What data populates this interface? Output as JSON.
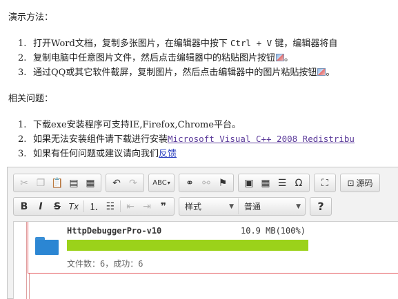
{
  "demo": {
    "heading": "演示方法：",
    "items": [
      {
        "num": "1.",
        "text_a": "打开Word文档，复制多张图片，在编辑器中按下 ",
        "keys": "Ctrl + V",
        "text_b": " 键，编辑器将自"
      },
      {
        "num": "2.",
        "text": "复制电脑中任意图片文件，然后点击编辑器中的粘贴图片按钮",
        "end": "。"
      },
      {
        "num": "3.",
        "text": "通过QQ或其它软件截屏，复制图片，然后点击编辑器中的图片粘贴按钮",
        "end": "。"
      }
    ]
  },
  "issues": {
    "heading": "相关问题：",
    "items": [
      {
        "num": "1.",
        "text": "下载exe安装程序可支持IE,Firefox,Chrome平台。"
      },
      {
        "num": "2.",
        "text": "如果无法安装组件请下载进行安装",
        "link": "Microsoft Visual C++ 2008 Redistribu"
      },
      {
        "num": "3.",
        "text": "如果有任何问题或建议请向我们",
        "link": "反馈"
      }
    ]
  },
  "toolbar": {
    "row1": {
      "group1": [
        "cut-icon",
        "copy-icon",
        "paste-icon",
        "paste-text-icon",
        "paste-word-icon"
      ],
      "group2": [
        "undo-icon",
        "redo-icon"
      ],
      "spellcheck_label": "ABC",
      "group4": [
        "link-icon",
        "unlink-icon",
        "anchor-icon"
      ],
      "group5": [
        "image-icon",
        "table-icon",
        "horizontal-rule-icon",
        "special-char-icon"
      ],
      "maximize": "maximize-icon",
      "source_label": "源码"
    },
    "row2": {
      "bold": "B",
      "italic": "I",
      "strike": "S",
      "remove_format": "Tx",
      "style_label": "样式",
      "format_label": "普通",
      "help": "?"
    }
  },
  "upload": {
    "file_name": "HttpDebuggerPro-v10",
    "file_size": "10.9 MB(100%)",
    "progress": 1.0,
    "status": "文件数：6，成功：6",
    "colors": {
      "progress": "#9bd21a",
      "border": "#e4545a",
      "folder": "#2b86d3"
    }
  }
}
